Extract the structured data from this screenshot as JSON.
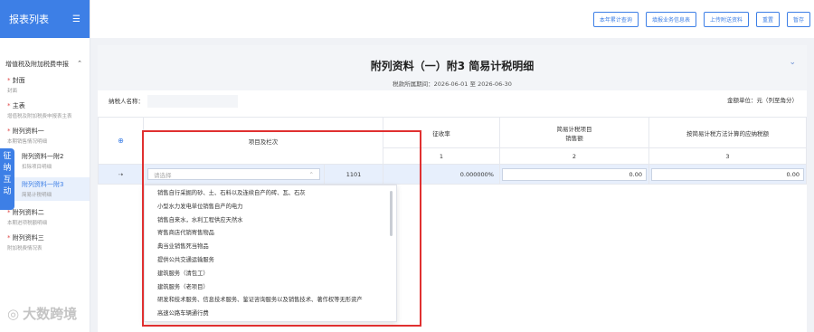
{
  "sidebar": {
    "title": "报表列表",
    "group": "增值税及附加税费申报",
    "items": [
      {
        "label": "封面",
        "sub": "封面"
      },
      {
        "label": "主表",
        "sub": "增值税及附加税费申报表主表"
      },
      {
        "label": "附列资料一",
        "sub": "本期销售情况明细"
      }
    ],
    "subitems": [
      {
        "label": "附列资料一附2",
        "sub": "扣除项目明细"
      },
      {
        "label": "附列资料一附3",
        "sub": "简易计税明细"
      }
    ],
    "items2": [
      {
        "label": "附列资料二",
        "sub": "本期进项税额明细"
      },
      {
        "label": "附列资料三",
        "sub": "附加税费情况表"
      }
    ],
    "float_tab": "征纳互动",
    "watermark": "大数跨境"
  },
  "toolbar": {
    "buttons": [
      "本年累计查询",
      "填报业务信息表",
      "上传附送资料",
      "重置",
      "暂存"
    ]
  },
  "main": {
    "title": "附列资料（一）附3 简易计税明细",
    "period": "税款所属期间：2026-06-01 至 2026-06-30",
    "payer_label": "纳税人名称：",
    "unit": "金额单位：元（列至角分）"
  },
  "table": {
    "col_item": "项目及栏次",
    "col_rate": "征收率",
    "col_sales": "简易计税项目\n销售额",
    "col_tax": "按简易计税方法计算的应纳税额",
    "idx": [
      "1",
      "2",
      "3"
    ],
    "row": {
      "placeholder": "请选择",
      "code": "1101",
      "rate": "0.000000%",
      "sales": "0.00",
      "tax": "0.00"
    }
  },
  "dropdown": {
    "options": [
      "销售自行采掘的砂、土、石料以及连续自产的砖、瓦、石灰",
      "小型水力发电单位销售自产的电力",
      "销售自来水，水利工程供应天然水",
      "寄售商店代销寄售物品",
      "典当业销售死当物品",
      "提供公共交通运输服务",
      "建筑服务（清包工）",
      "建筑服务（老项目）",
      "研发和技术服务、信息技术服务、鉴证咨询服务以及销售技术、著作权等无形资产",
      "高速公路车辆通行费"
    ]
  }
}
